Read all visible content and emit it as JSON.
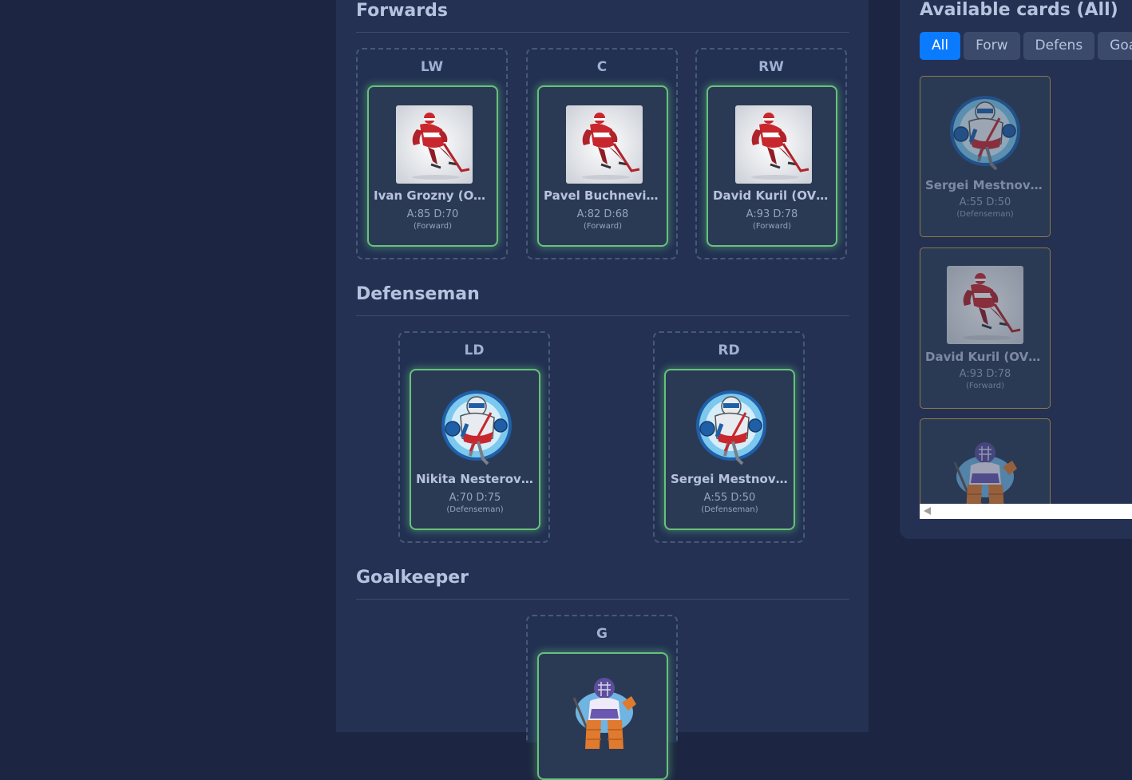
{
  "lineup": {
    "forwards": {
      "title": "Forwards",
      "slots": [
        {
          "label": "LW",
          "name": "Ivan Grozny (OVR...",
          "stats": "A:85 D:70",
          "role": "(Forward)"
        },
        {
          "label": "C",
          "name": "Pavel Buchnevich...",
          "stats": "A:82 D:68",
          "role": "(Forward)"
        },
        {
          "label": "RW",
          "name": "David Kuril (OVR...",
          "stats": "A:93 D:78",
          "role": "(Forward)"
        }
      ]
    },
    "defense": {
      "title": "Defenseman",
      "slots": [
        {
          "label": "LD",
          "name": "Nikita Nesterov (OVR...",
          "stats": "A:70 D:75",
          "role": "(Defenseman)"
        },
        {
          "label": "RD",
          "name": "Sergei Mestnov (OVR...",
          "stats": "A:55 D:50",
          "role": "(Defenseman)"
        }
      ]
    },
    "goalie": {
      "title": "Goalkeeper",
      "slots": [
        {
          "label": "G"
        }
      ]
    }
  },
  "available": {
    "title": "Available cards (All)",
    "filters": [
      "All",
      "Forw",
      "Defens",
      "Goa"
    ],
    "active_filter": "All",
    "cards": [
      {
        "name": "Sergei Mestnov (OVR...",
        "stats": "A:55 D:50",
        "role": "(Defenseman)",
        "icon": "defenseman-avatar"
      },
      {
        "name": "David Kuril (OVR...",
        "stats": "A:93 D:78",
        "role": "(Forward)",
        "icon": "forward-avatar"
      },
      {
        "icon": "goalkeeper-avatar"
      }
    ]
  },
  "colors": {
    "page_bg": "#1c2541",
    "panel_bg": "#243153",
    "card_glow": "#66c27c",
    "accent": "#0a7bff"
  }
}
